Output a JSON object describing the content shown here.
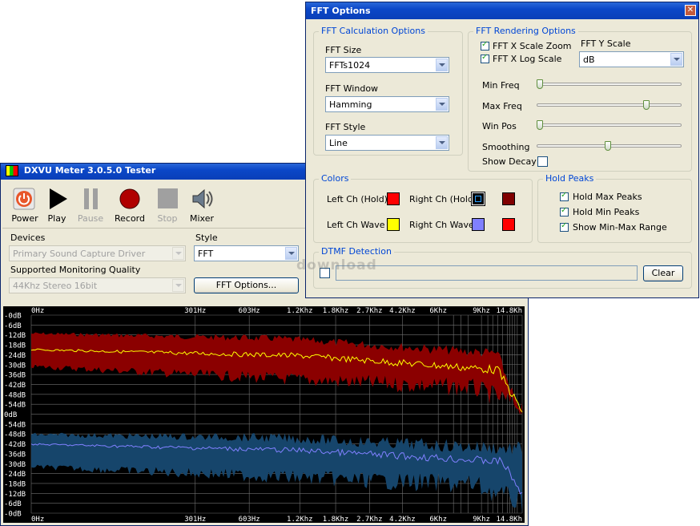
{
  "main_window": {
    "title": "DXVU Meter 3.0.5.0 Tester",
    "toolbar": [
      {
        "label": "Power",
        "icon": "power-icon",
        "enabled": true
      },
      {
        "label": "Play",
        "icon": "play-icon",
        "enabled": true
      },
      {
        "label": "Pause",
        "icon": "pause-icon",
        "enabled": false
      },
      {
        "label": "Record",
        "icon": "record-icon",
        "enabled": true
      },
      {
        "label": "Stop",
        "icon": "stop-icon",
        "enabled": false
      },
      {
        "label": "Mixer",
        "icon": "speaker-icon",
        "enabled": true
      }
    ],
    "devices_label": "Devices",
    "devices_value": "Primary Sound Capture Driver",
    "style_label": "Style",
    "style_value": "FFT",
    "quality_label": "Supported Monitoring Quality",
    "quality_value": "44Khz Stereo 16bit",
    "fft_options_button": "FFT Options..."
  },
  "spectrum": {
    "freq_labels": [
      "0Hz",
      "301Hz",
      "603Hz",
      "1.2Khz",
      "1.8Khz",
      "2.7Khz",
      "4.2Khz",
      "6Khz",
      "9Khz",
      "14.8Kh"
    ],
    "db_labels": [
      "-0dB",
      "-6dB",
      "-12dB",
      "-18dB",
      "-24dB",
      "-30dB",
      "-36dB",
      "-42dB",
      "-48dB",
      "-54dB",
      "0dB",
      "-54dB",
      "-48dB",
      "-42dB",
      "-36dB",
      "-30dB",
      "-24dB",
      "-18dB",
      "-12dB",
      "-6dB",
      "-0dB"
    ],
    "colors": {
      "left_fill": "#8b0000",
      "left_wave": "#ffff00",
      "right_fill": "#16456b",
      "right_wave": "#8080ff",
      "grid": "#707070"
    }
  },
  "fft_dialog": {
    "title": "FFT Options",
    "calc_group": "FFT Calculation Options",
    "fft_size_label": "FFT Size",
    "fft_size_value": "FFTs1024",
    "fft_window_label": "FFT Window",
    "fft_window_value": "Hamming",
    "fft_style_label": "FFT Style",
    "fft_style_value": "Line",
    "render_group": "FFT Rendering Options",
    "x_scale_zoom": {
      "label": "FFT X Scale Zoom",
      "checked": true
    },
    "x_log_scale": {
      "label": "FFT X Log Scale",
      "checked": true
    },
    "y_scale_label": "FFT Y Scale",
    "y_scale_value": "dB",
    "sliders": [
      {
        "label": "Min Freq",
        "value": 0.0
      },
      {
        "label": "Max Freq",
        "value": 0.77
      },
      {
        "label": "Win Pos",
        "value": 0.0
      },
      {
        "label": "Smoothing",
        "value": 0.49
      }
    ],
    "show_decay": {
      "label": "Show Decay",
      "checked": false
    },
    "colors_group": "Colors",
    "left_hold": {
      "label": "Left Ch (Hold)",
      "color": "#ff0000"
    },
    "right_hold": {
      "label": "Right Ch (Hold)",
      "color": "#000000",
      "color2": "#800000"
    },
    "left_wave": {
      "label": "Left Ch Wave",
      "color": "#ffff00"
    },
    "right_wave": {
      "label": "Right Ch Wave",
      "color": "#8080ff",
      "color2": "#ff0000"
    },
    "hold_group": "Hold Peaks",
    "hold_max": {
      "label": "Hold Max Peaks",
      "checked": true
    },
    "hold_min": {
      "label": "Hold Min Peaks",
      "checked": true
    },
    "show_minmax": {
      "label": "Show Min-Max Range",
      "checked": true
    },
    "dtmf_group": "DTMF Detection",
    "clear_button": "Clear",
    "watermark": "download"
  }
}
